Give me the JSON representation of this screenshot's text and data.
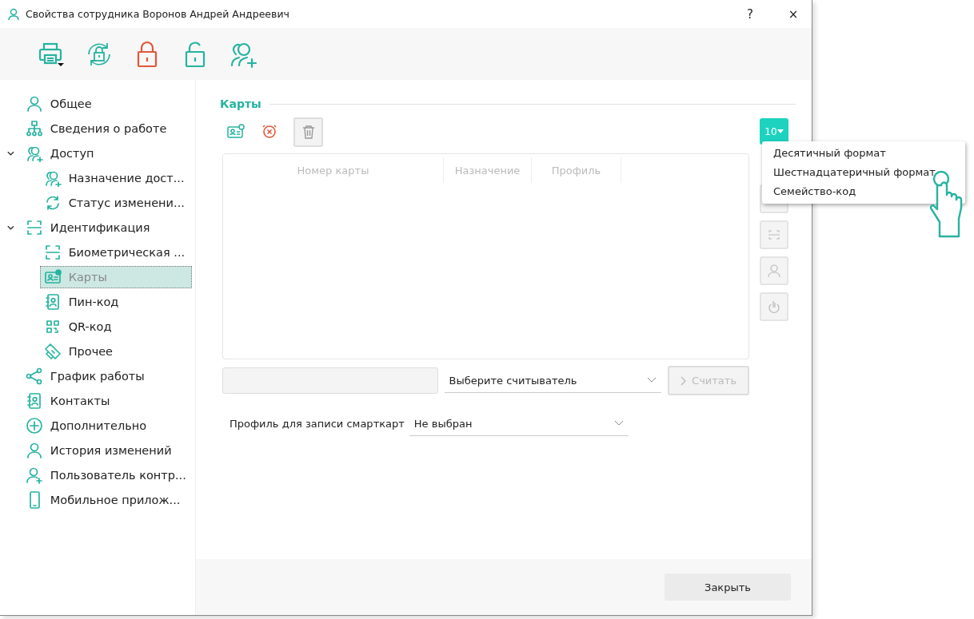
{
  "window": {
    "title": "Свойства сотрудника Воронов  Андрей Андреевич",
    "buttons": [
      "?",
      "×"
    ]
  },
  "sidebar": {
    "items": [
      {
        "label": "Общее",
        "kind": "person",
        "selected": false
      },
      {
        "label": "Сведения о работе",
        "kind": "org",
        "selected": false
      },
      {
        "label": "Доступ",
        "kind": "access",
        "selected": false,
        "expanded": true,
        "children": [
          {
            "label": "Назначение дост...",
            "kind": "access",
            "selected": false
          },
          {
            "label": "Статус изменени...",
            "kind": "sync",
            "selected": false
          }
        ]
      },
      {
        "label": "Идентификация",
        "kind": "frame",
        "selected": false,
        "expanded": true,
        "children": [
          {
            "label": "Биометрическая ...",
            "kind": "frame",
            "selected": false
          },
          {
            "label": "Карты",
            "kind": "card",
            "selected": true
          },
          {
            "label": "Пин-код",
            "kind": "contact",
            "selected": false
          },
          {
            "label": "QR-код",
            "kind": "qr",
            "selected": false
          },
          {
            "label": "Прочее",
            "kind": "tag",
            "selected": false
          }
        ]
      },
      {
        "label": "График работы",
        "kind": "share",
        "selected": false
      },
      {
        "label": "Контакты",
        "kind": "contact",
        "selected": false
      },
      {
        "label": "Дополнительно",
        "kind": "plus",
        "selected": false
      },
      {
        "label": "История изменений",
        "kind": "person",
        "selected": false
      },
      {
        "label": "Пользователь контр...",
        "kind": "useradd",
        "selected": false
      },
      {
        "label": "Мобильное прилож...",
        "kind": "phone",
        "selected": false
      }
    ]
  },
  "section": {
    "title": "Карты",
    "table": {
      "columns": [
        "Номер карты",
        "Назначение",
        "Профиль"
      ]
    },
    "format_button": {
      "label": "10"
    },
    "format_menu": {
      "items": [
        "Десятичный формат",
        "Шестнадцатеричный формат",
        "Семейство-код"
      ]
    },
    "reader_select": {
      "value": "Выберите считыватель"
    },
    "read_button": {
      "label": "Считать",
      "disabled": true
    },
    "profile": {
      "label": "Профиль для записи смарткарт",
      "value": "Не выбран"
    }
  },
  "footer": {
    "close_button": "Закрыть"
  }
}
